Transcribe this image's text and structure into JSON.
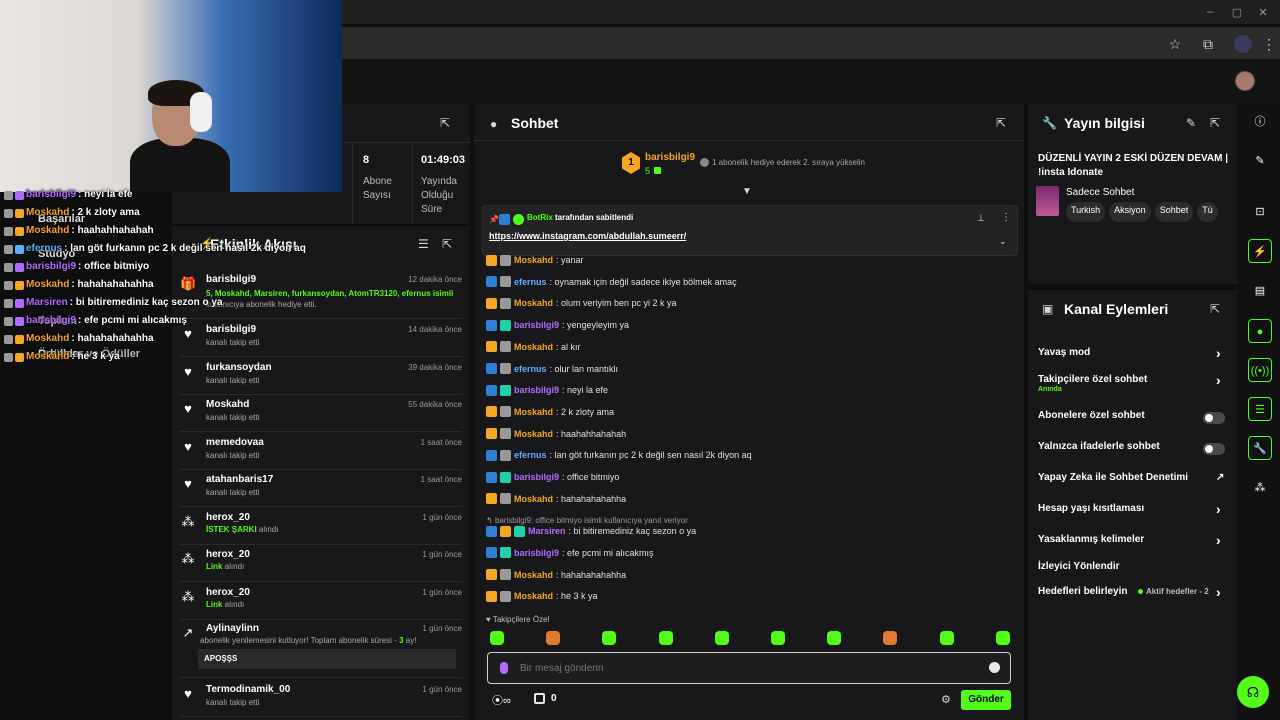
{
  "colors": {
    "accent": "#53fc18",
    "mod": "#f5a623",
    "user_green": "#53fc18",
    "user_blue": "#5ab0ff",
    "user_purple": "#b36bff"
  },
  "webcam_overlay": {
    "menu": [
      "Başarılar",
      "Stüdyo",
      "Toplum",
      "Ödüller"
    ],
    "menu_extra": [
      "Dropslar ve Ödüller"
    ],
    "lines": [
      {
        "user": "barisbilgi9",
        "text": ": neyi la efe",
        "color": "#b36bff"
      },
      {
        "user": "Moskahd",
        "text": ": 2 k zloty ama",
        "color": "#f5a623"
      },
      {
        "user": "Moskahd",
        "text": ": haahahhahahah",
        "color": "#f5a623"
      },
      {
        "user": "efernus",
        "text": ": lan göt furkanın pc 2 k değil sen nasıl 2k diyon aq",
        "color": "#5ab0ff"
      },
      {
        "user": "barisbilgi9",
        "text": ": office bitmiyo",
        "color": "#b36bff"
      },
      {
        "user": "Moskahd",
        "text": ": hahahahahahha",
        "color": "#f5a623"
      },
      {
        "user": "Marsiren",
        "text": ": bi bitiremediniz kaç sezon o ya",
        "color": "#b36bff"
      },
      {
        "user": "barisbilgi9",
        "text": ": efe pcmi mi alıcakmış",
        "color": "#b36bff"
      },
      {
        "user": "Moskahd",
        "text": ": hahahahahahha",
        "color": "#f5a623"
      },
      {
        "user": "Moskahd",
        "text": ": he 3 k ya",
        "color": "#f5a623"
      }
    ]
  },
  "stats": [
    {
      "value": "8",
      "label": "Abone Sayısı"
    },
    {
      "value": "01:49:03",
      "label": "Yayında Olduğu Süre"
    }
  ],
  "events": {
    "title": "Etkinlik Akışı",
    "items": [
      {
        "icon": "gift-icon",
        "name": "barisbilgi9",
        "time": "12 dakika önce",
        "sub": "5, Moskahd, Marsiren, furkansoydan, AtomTR3120, efernus isimli",
        "sub2": "kullanıcıya abonelik hediye etti."
      },
      {
        "icon": "heart-icon",
        "name": "barisbilgi9",
        "time": "14 dakika önce",
        "sub": "kanalı takip etti"
      },
      {
        "icon": "heart-icon",
        "name": "furkansoydan",
        "time": "39 dakika önce",
        "sub": "kanalı takip etti"
      },
      {
        "icon": "heart-icon",
        "name": "Moskahd",
        "time": "55 dakika önce",
        "sub": "kanalı takip etti"
      },
      {
        "icon": "heart-icon",
        "name": "memedovaa",
        "time": "1 saat önce",
        "sub": "kanalı takip etti"
      },
      {
        "icon": "heart-icon",
        "name": "atahanbaris17",
        "time": "1 saat önce",
        "sub": "kanalı takip etti"
      },
      {
        "icon": "reward-icon",
        "name": "herox_20",
        "time": "1 gün önce",
        "sub_green": "İSTEK ŞARKI",
        "sub": " alındı"
      },
      {
        "icon": "reward-icon",
        "name": "herox_20",
        "time": "1 gün önce",
        "sub_green": "Link",
        "sub": " alındı"
      },
      {
        "icon": "reward-icon",
        "name": "herox_20",
        "time": "1 gün önce",
        "sub_green": "Link",
        "sub": " alındı"
      },
      {
        "icon": "star-icon",
        "name": "Aylinaylinn",
        "time": "1 gün önce",
        "sub": "abonelik yenilemesini kutluyor! Toplam abonelik süresi - ",
        "sub_green": "3",
        "sub_tail": " ay!",
        "msg": "APOŞŞS"
      },
      {
        "icon": "heart-icon",
        "name": "Termodinamik_00",
        "time": "1 gün önce",
        "sub": "kanalı takip etti"
      }
    ]
  },
  "chat": {
    "title": "Sohbet",
    "top_gifter": {
      "rank": "1",
      "name": "barisbilgi9",
      "count": "5",
      "text": "1 abonelik hediye ederek 2. sıraya yükselin"
    },
    "pinned": {
      "by": "BotRix",
      "by_suffix": " tarafından sabitlendi",
      "link": "https://www.instagram.com/abdullah.sumeerr/"
    },
    "messages": [
      {
        "user": "Moskahd",
        "color": "#f5a623",
        "text": ": yanar",
        "badges": [
          "crown",
          "cloud"
        ]
      },
      {
        "user": "efernus",
        "color": "#5ab0ff",
        "text": ": oynamak için değil sadece ikiye bölmek amaç",
        "badges": [
          "blue",
          "cloud"
        ]
      },
      {
        "user": "Moskahd",
        "color": "#f5a623",
        "text": ": olum veriyim ben pc yi 2 k ya",
        "badges": [
          "crown",
          "cloud"
        ]
      },
      {
        "user": "barisbilgi9",
        "color": "#b36bff",
        "text": ": yengeyleyim ya",
        "badges": [
          "blue",
          "gift"
        ]
      },
      {
        "user": "Moskahd",
        "color": "#f5a623",
        "text": ": al kır",
        "badges": [
          "crown",
          "cloud"
        ]
      },
      {
        "user": "efernus",
        "color": "#5ab0ff",
        "text": ": olur lan mantıklı",
        "badges": [
          "blue",
          "cloud"
        ]
      },
      {
        "user": "barisbilgi9",
        "color": "#b36bff",
        "text": ": neyi la efe",
        "badges": [
          "blue",
          "gift"
        ]
      },
      {
        "user": "Moskahd",
        "color": "#f5a623",
        "text": ": 2 k zloty ama",
        "badges": [
          "crown",
          "cloud"
        ]
      },
      {
        "user": "Moskahd",
        "color": "#f5a623",
        "text": ": haahahhahahah",
        "badges": [
          "crown",
          "cloud"
        ]
      },
      {
        "user": "efernus",
        "color": "#5ab0ff",
        "text": ": lan göt furkanın pc 2 k değil sen nasıl 2k diyon aq",
        "badges": [
          "blue",
          "cloud"
        ]
      },
      {
        "user": "barisbilgi9",
        "color": "#b36bff",
        "text": ": office bitmiyo",
        "badges": [
          "blue",
          "gift"
        ]
      },
      {
        "user": "Moskahd",
        "color": "#f5a623",
        "text": ": hahahahahahha",
        "badges": [
          "crown",
          "cloud"
        ]
      }
    ],
    "reply_hint": "barisbilgi9: office bitmiyo isimli kullanıcıya yanıt veriyor",
    "messages2": [
      {
        "user": "Marsiren",
        "color": "#b36bff",
        "text": ": bi bitiremediniz kaç sezon o ya",
        "badges": [
          "blue",
          "crown",
          "gift"
        ]
      },
      {
        "user": "barisbilgi9",
        "color": "#b36bff",
        "text": ": efe pcmi mi alıcakmış",
        "badges": [
          "blue",
          "gift"
        ]
      },
      {
        "user": "Moskahd",
        "color": "#f5a623",
        "text": ": hahahahahahha",
        "badges": [
          "crown",
          "cloud"
        ]
      },
      {
        "user": "Moskahd",
        "color": "#f5a623",
        "text": ": he 3 k ya",
        "badges": [
          "crown",
          "cloud"
        ]
      }
    ],
    "emote_label": "Takipçilere Özel",
    "input_placeholder": "Bir mesaj gönderin",
    "points": "0",
    "send_label": "Gönder"
  },
  "stream_info": {
    "title": "Yayın bilgisi",
    "stream_title": "DÜZENLİ YAYIN 2 ESKİ DÜZEN DEVAM | !insta Idonate",
    "category": "Sadece Sohbet",
    "tags": [
      "Turkish",
      "Aksiyon",
      "Sohbet",
      "Tü"
    ]
  },
  "channel_actions": {
    "title": "Kanal Eylemleri",
    "rows": [
      {
        "label": "Yavaş mod",
        "type": "chevron"
      },
      {
        "label": "Takipçilere özel sohbet",
        "sub": "Anında",
        "type": "chevron"
      },
      {
        "label": "Abonelere özel sohbet",
        "type": "toggle"
      },
      {
        "label": "Yalnızca ifadelerle sohbet",
        "type": "toggle"
      },
      {
        "label": "Yapay Zeka ile Sohbet Denetimi",
        "type": "external"
      },
      {
        "label": "Hesap yaşı kısıtlaması",
        "type": "chevron"
      },
      {
        "label": "Yasaklanmış kelimeler",
        "type": "chevron"
      },
      {
        "label": "İzleyici Yönlendir",
        "type": "none"
      },
      {
        "label": "Hedefleri belirleyin",
        "type": "chevron",
        "status": "Aktif hedefler - 2"
      }
    ]
  }
}
